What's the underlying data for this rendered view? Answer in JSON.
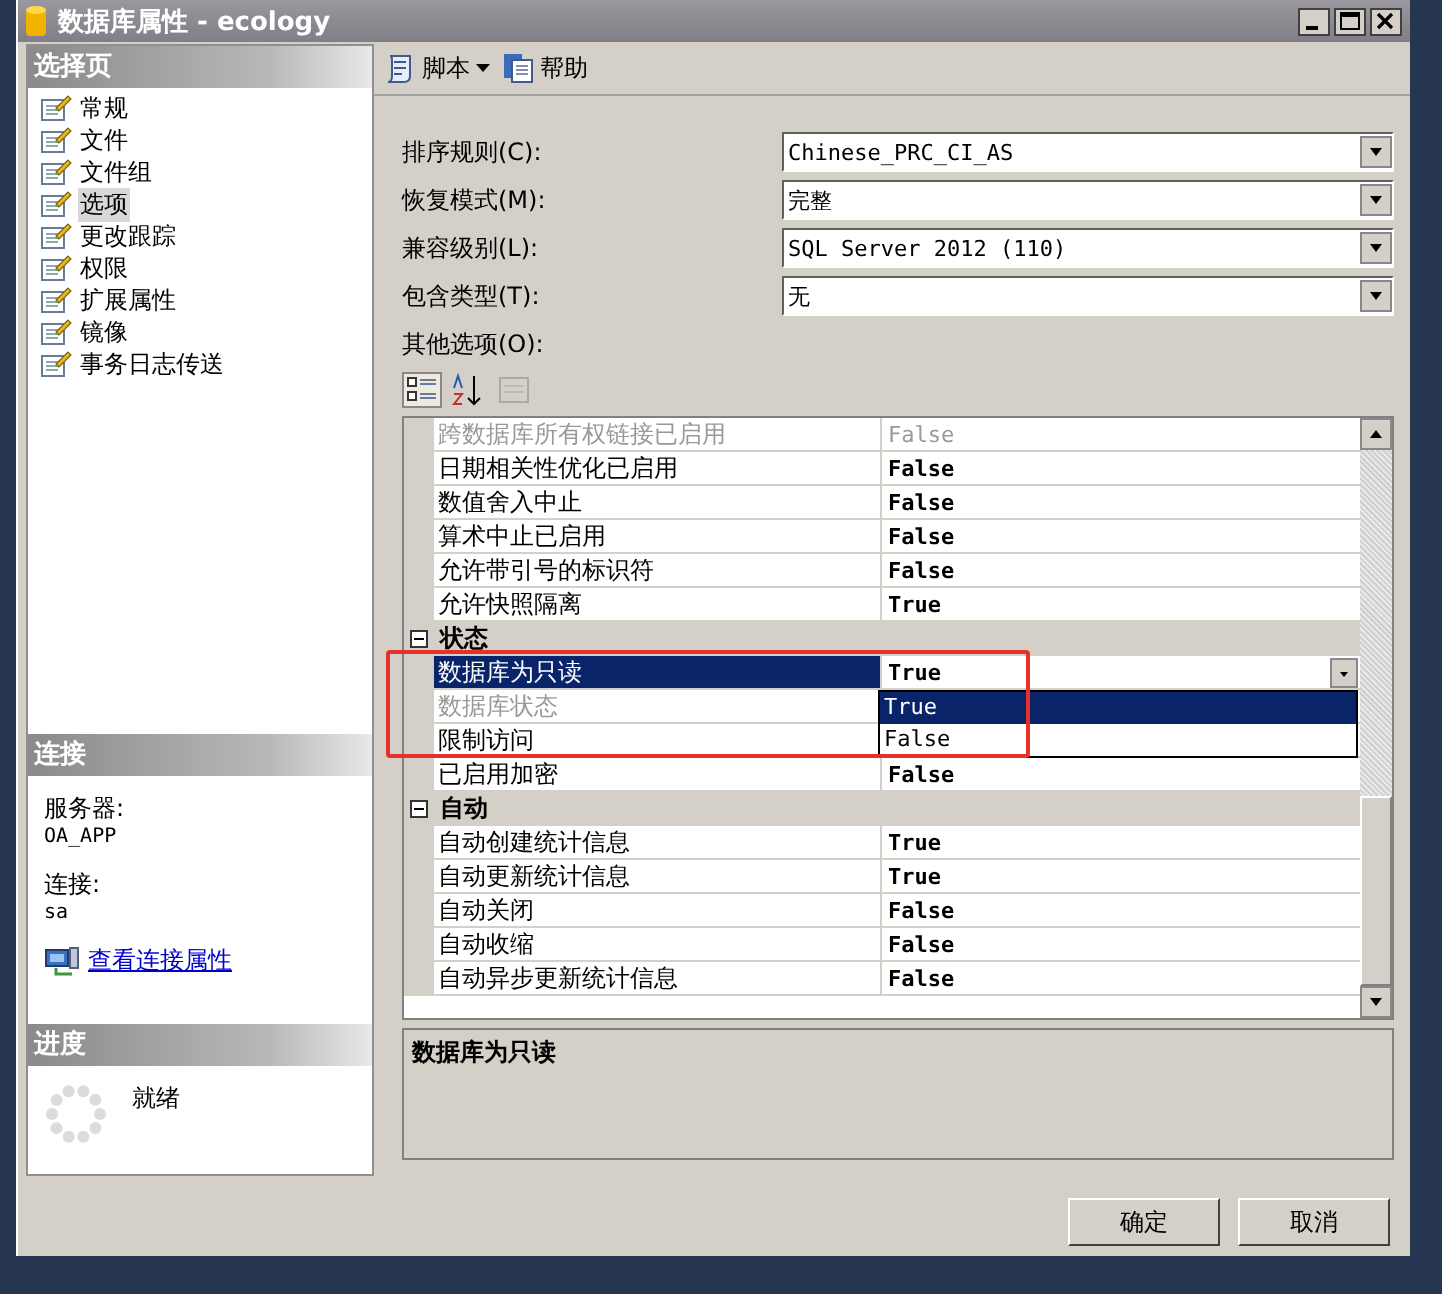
{
  "window": {
    "title": "数据库属性 - ecology"
  },
  "sidebar": {
    "header": "选择页",
    "items": [
      {
        "label": "常规",
        "selected": false
      },
      {
        "label": "文件",
        "selected": false
      },
      {
        "label": "文件组",
        "selected": false
      },
      {
        "label": "选项",
        "selected": true
      },
      {
        "label": "更改跟踪",
        "selected": false
      },
      {
        "label": "权限",
        "selected": false
      },
      {
        "label": "扩展属性",
        "selected": false
      },
      {
        "label": "镜像",
        "selected": false
      },
      {
        "label": "事务日志传送",
        "selected": false
      }
    ]
  },
  "connection": {
    "header": "连接",
    "server_label": "服务器:",
    "server": "OA_APP",
    "connection_label": "连接:",
    "connection": "sa",
    "link": "查看连接属性"
  },
  "progress": {
    "header": "进度",
    "status": "就绪"
  },
  "toolbar": [
    {
      "label": "脚本",
      "kind": "script"
    },
    {
      "label": "帮助",
      "kind": "help"
    }
  ],
  "fields": [
    {
      "label": "排序规则(C):",
      "value": "Chinese_PRC_CI_AS"
    },
    {
      "label": "恢复模式(M):",
      "value": "完整"
    },
    {
      "label": "兼容级别(L):",
      "value": "SQL Server 2012 (110)"
    },
    {
      "label": "包含类型(T):",
      "value": "无"
    }
  ],
  "other_options_label": "其他选项(O):",
  "grid": {
    "rows": [
      {
        "kind": "property",
        "name": "跨数据库所有权链接已启用",
        "value": "False",
        "disabled": true,
        "selected": false
      },
      {
        "kind": "property",
        "name": "日期相关性优化已启用",
        "value": "False",
        "disabled": false,
        "selected": false
      },
      {
        "kind": "property",
        "name": "数值舍入中止",
        "value": "False",
        "disabled": false,
        "selected": false
      },
      {
        "kind": "property",
        "name": "算术中止已启用",
        "value": "False",
        "disabled": false,
        "selected": false
      },
      {
        "kind": "property",
        "name": "允许带引号的标识符",
        "value": "False",
        "disabled": false,
        "selected": false
      },
      {
        "kind": "property",
        "name": "允许快照隔离",
        "value": "True",
        "disabled": false,
        "selected": false
      },
      {
        "kind": "category",
        "name": "状态",
        "expanded": true
      },
      {
        "kind": "property",
        "name": "数据库为只读",
        "value": "True",
        "disabled": false,
        "selected": true
      },
      {
        "kind": "property",
        "name": "数据库状态",
        "disabled": true,
        "selected": false
      },
      {
        "kind": "property",
        "name": "限制访问",
        "disabled": false,
        "selected": false
      },
      {
        "kind": "property",
        "name": "已启用加密",
        "value": "False",
        "disabled": false,
        "selected": false
      },
      {
        "kind": "category",
        "name": "自动",
        "expanded": true
      },
      {
        "kind": "property",
        "name": "自动创建统计信息",
        "value": "True",
        "disabled": false,
        "selected": false
      },
      {
        "kind": "property",
        "name": "自动更新统计信息",
        "value": "True",
        "disabled": false,
        "selected": false
      },
      {
        "kind": "property",
        "name": "自动关闭",
        "value": "False",
        "disabled": false,
        "selected": false
      },
      {
        "kind": "property",
        "name": "自动收缩",
        "value": "False",
        "disabled": false,
        "selected": false
      },
      {
        "kind": "property",
        "name": "自动异步更新统计信息",
        "value": "False",
        "disabled": false,
        "selected": false
      }
    ]
  },
  "dropdown": {
    "options": [
      {
        "label": "True",
        "selected": true
      },
      {
        "label": "False",
        "selected": false
      }
    ]
  },
  "description": "数据库为只读",
  "buttons": [
    "确定",
    "取消"
  ]
}
